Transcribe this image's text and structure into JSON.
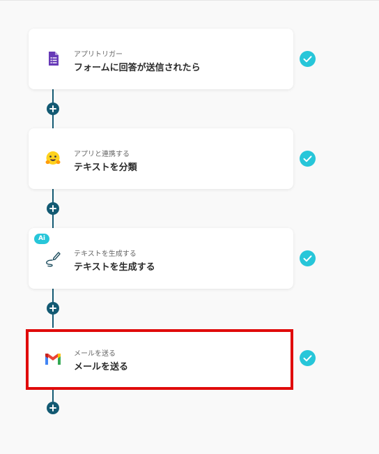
{
  "steps": [
    {
      "subtitle": "アプリトリガー",
      "title": "フォームに回答が送信されたら",
      "icon": "google-forms-icon",
      "status": "complete",
      "selected": false
    },
    {
      "subtitle": "アプリと連携する",
      "title": "テキストを分類",
      "icon": "hugging-face-icon",
      "status": "complete",
      "selected": false
    },
    {
      "subtitle": "テキストを生成する",
      "title": "テキストを生成する",
      "icon": "pen-curve-icon",
      "badge": "Ai",
      "status": "complete",
      "selected": false
    },
    {
      "subtitle": "メールを送る",
      "title": "メールを送る",
      "icon": "gmail-icon",
      "status": "complete",
      "selected": true
    }
  ],
  "colors": {
    "connector": "#135a73",
    "check": "#27c6d9",
    "selection": "#e00b0b",
    "background": "#f9f9f9"
  }
}
